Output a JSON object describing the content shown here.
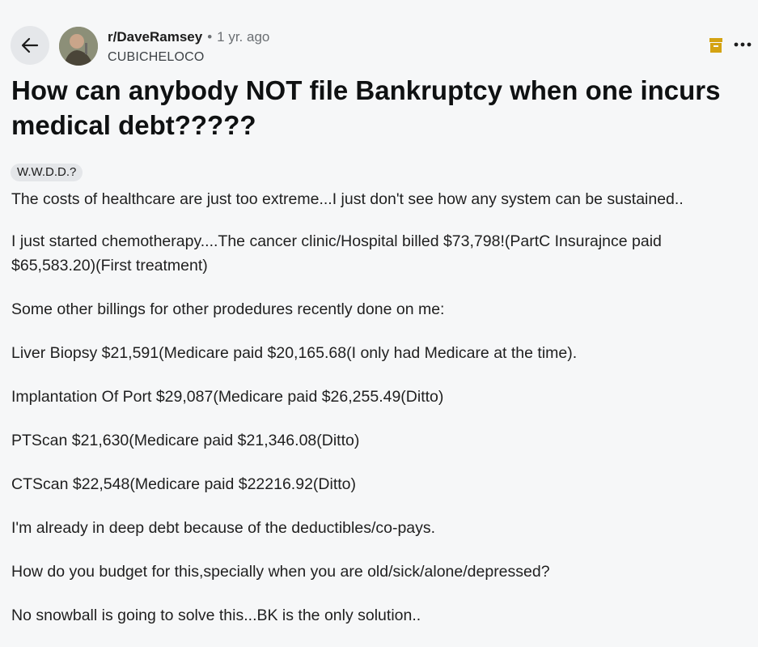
{
  "header": {
    "subreddit": "r/DaveRamsey",
    "separator": "•",
    "age": "1 yr. ago",
    "author": "CUBICHELOCO"
  },
  "post": {
    "title": "How can anybody NOT file Bankruptcy when one incurs medical debt?????",
    "flair": "W.W.D.D.?",
    "paragraphs": [
      "The costs of healthcare are just too extreme...I just don't see how any system can be sustained..",
      "I just started chemotherapy....The cancer clinic/Hospital billed $73,798!(PartC Insurajnce paid $65,583.20)(First treatment)",
      "Some other billings for other prodedures recently done on me:",
      "Liver Biopsy $21,591(Medicare paid $20,165.68(I only had Medicare at the time).",
      "Implantation Of Port $29,087(Medicare paid $26,255.49(Ditto)",
      "PTScan $21,630(Medicare paid $21,346.08(Ditto)",
      "CTScan $22,548(Medicare paid $22216.92(Ditto)",
      "I'm already in deep debt because of the deductibles/co-pays.",
      "How do you budget for this,specially when you are old/sick/alone/depressed?",
      "No snowball is going to solve this...BK is the only solution.."
    ]
  },
  "icons": {
    "back": "arrow-left-icon",
    "archive": "archive-icon",
    "more": "more-options-icon"
  },
  "colors": {
    "background": "#f6f7f8",
    "archive": "#d4a312",
    "flair_bg": "#e4e6e9"
  }
}
